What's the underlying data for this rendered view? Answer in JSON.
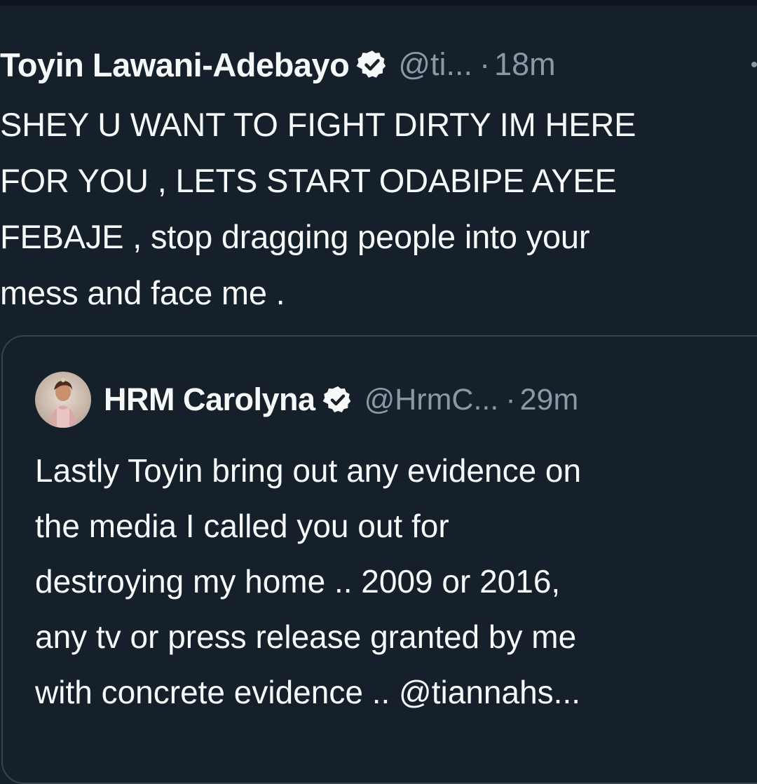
{
  "tweet": {
    "author_name": "Toyin Lawani-Adebayo",
    "handle": "@ti...",
    "separator": "·",
    "time": "18m",
    "text": "SHEY U WANT TO FIGHT DIRTY IM HERE\nFOR YOU , LETS START ODABIPE AYEE\nFEBAJE , stop dragging people into your\nmess and face me ."
  },
  "quoted_tweet": {
    "author_name": "HRM Carolyna",
    "handle": "@HrmC...",
    "separator": "·",
    "time": "29m",
    "text": "Lastly Toyin bring out any evidence on\nthe media I called you out for\ndestroying my home .. 2009 or 2016,\nany tv or press release granted by me\nwith concrete evidence .. @tiannahs..."
  },
  "icons": {
    "verified": "verified-badge-icon",
    "more": "more-options-icon"
  },
  "colors": {
    "background": "#15202b",
    "text_primary": "#f7f9f9",
    "text_secondary": "#8b98a5",
    "border": "#38444d"
  }
}
